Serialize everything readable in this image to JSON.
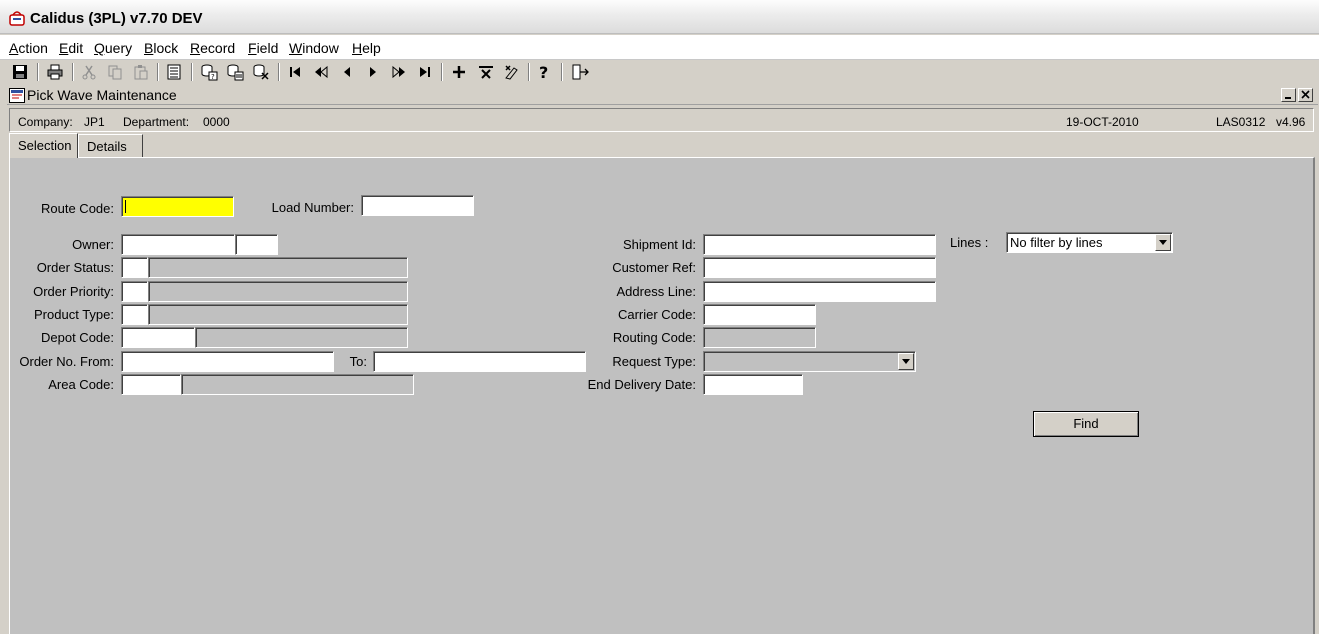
{
  "app": {
    "title": "Calidus (3PL) v7.70 DEV"
  },
  "menu": [
    "Action",
    "Edit",
    "Query",
    "Block",
    "Record",
    "Field",
    "Window",
    "Help"
  ],
  "window": {
    "title": "Pick Wave Maintenance"
  },
  "info": {
    "company_label": "Company:",
    "company_value": "JP1",
    "department_label": "Department:",
    "department_value": "0000",
    "date": "19-OCT-2010",
    "module": "LAS0312",
    "version": "v4.96"
  },
  "tabs": [
    {
      "label": "Selection",
      "active": true
    },
    {
      "label": "Details",
      "active": false
    }
  ],
  "form": {
    "route_code": {
      "label": "Route Code:",
      "value": ""
    },
    "load_number": {
      "label": "Load Number:",
      "value": ""
    },
    "owner": {
      "label": "Owner:",
      "value": ""
    },
    "order_status": {
      "label": "Order Status:",
      "value": ""
    },
    "order_priority": {
      "label": "Order Priority:",
      "value": ""
    },
    "product_type": {
      "label": "Product Type:",
      "value": ""
    },
    "depot_code": {
      "label": "Depot Code:",
      "value": ""
    },
    "order_no_from": {
      "label": "Order No. From:",
      "value": ""
    },
    "order_no_to": {
      "label": "To:",
      "value": ""
    },
    "area_code": {
      "label": "Area Code:",
      "value": ""
    },
    "shipment_id": {
      "label": "Shipment Id:",
      "value": ""
    },
    "customer_ref": {
      "label": "Customer Ref:",
      "value": ""
    },
    "address_line": {
      "label": "Address Line:",
      "value": ""
    },
    "carrier_code": {
      "label": "Carrier Code:",
      "value": ""
    },
    "routing_code": {
      "label": "Routing Code:",
      "value": ""
    },
    "request_type": {
      "label": "Request Type:",
      "value": ""
    },
    "end_delivery_date": {
      "label": "End Delivery Date:",
      "value": ""
    },
    "lines": {
      "label": "Lines :",
      "value": "No filter by lines"
    }
  },
  "buttons": {
    "find": "Find"
  },
  "colors": {
    "focused_field": "#ffff00",
    "panel": "#c0c0c0"
  }
}
